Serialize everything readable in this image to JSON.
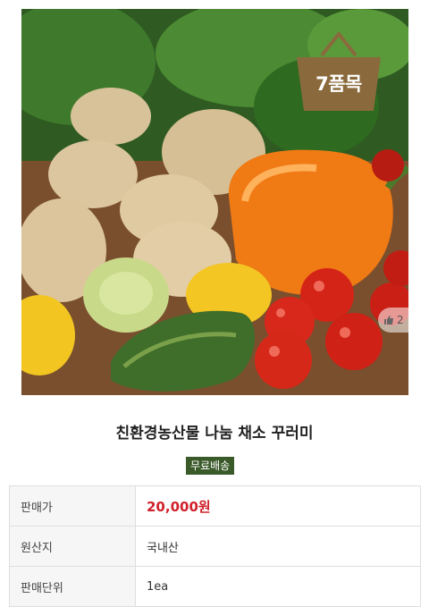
{
  "product": {
    "badge_count": "7품목",
    "like_count": "2",
    "title": "친환경농산물 나눔 채소 꾸러미",
    "shipping_badge": "무료배송",
    "icons": [
      "basket-badge-icon",
      "thumbs-up-icon"
    ]
  },
  "info": {
    "rows": [
      {
        "label": "판매가",
        "value": "20,000원"
      },
      {
        "label": "원산지",
        "value": "국내산"
      },
      {
        "label": "판매단위",
        "value": "1ea"
      }
    ]
  },
  "colors": {
    "badge": "#8a6a3c",
    "price": "#d0222c",
    "shipping_bg": "#3a5a2a"
  }
}
